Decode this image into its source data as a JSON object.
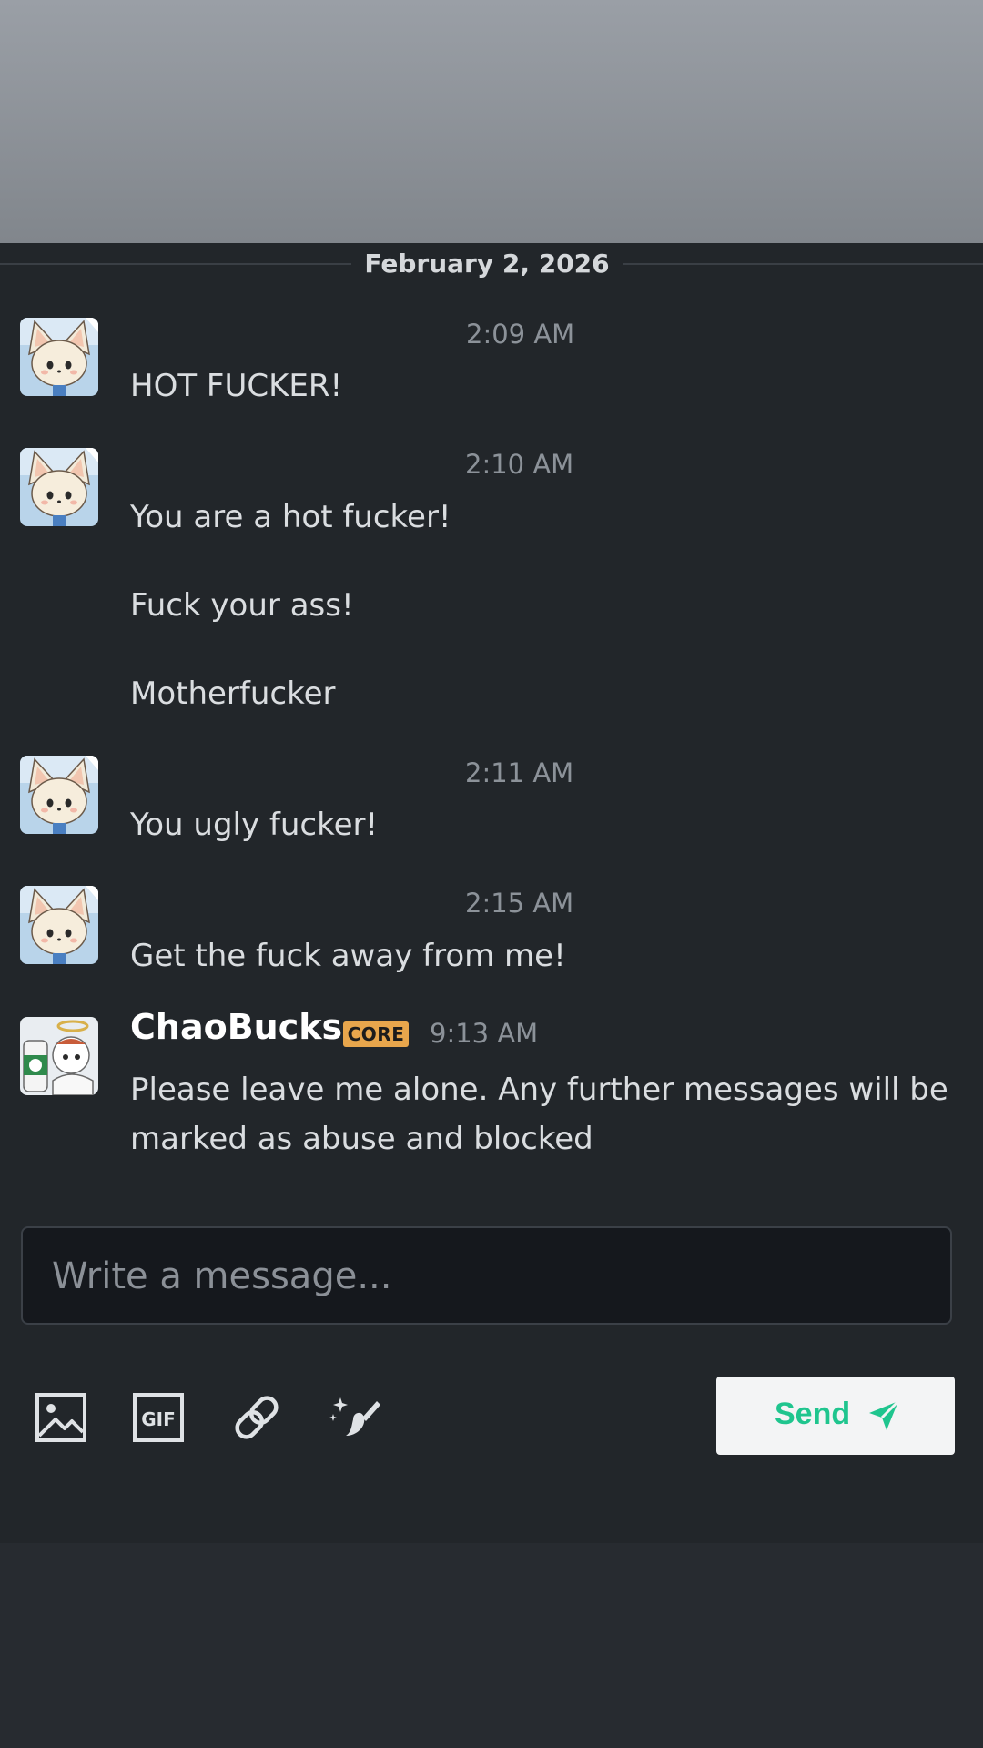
{
  "date_divider": "February 2, 2026",
  "messages": [
    {
      "time": "2:09 AM",
      "lines": [
        "HOT FUCKER!"
      ]
    },
    {
      "time": "2:10 AM",
      "lines": [
        "You are a hot fucker!",
        "Fuck your ass!",
        "Motherfucker"
      ]
    },
    {
      "time": "2:11 AM",
      "lines": [
        "You ugly fucker!"
      ]
    },
    {
      "time": "2:15 AM",
      "lines": [
        "Get the fuck away from me!"
      ]
    },
    {
      "username": "ChaoBucks",
      "badge": "CORE",
      "time": "9:13 AM",
      "lines": [
        "Please leave me alone. Any further messages will be marked as abuse and blocked"
      ]
    }
  ],
  "composer": {
    "placeholder": "Write a message...",
    "value": ""
  },
  "toolbar": {
    "icons": [
      "image-icon",
      "gif-icon",
      "link-icon",
      "sparkle-brush-icon"
    ],
    "send_label": "Send"
  },
  "colors": {
    "accent": "#1fc58e",
    "badge": "#e8a64c",
    "background": "#22262a"
  }
}
